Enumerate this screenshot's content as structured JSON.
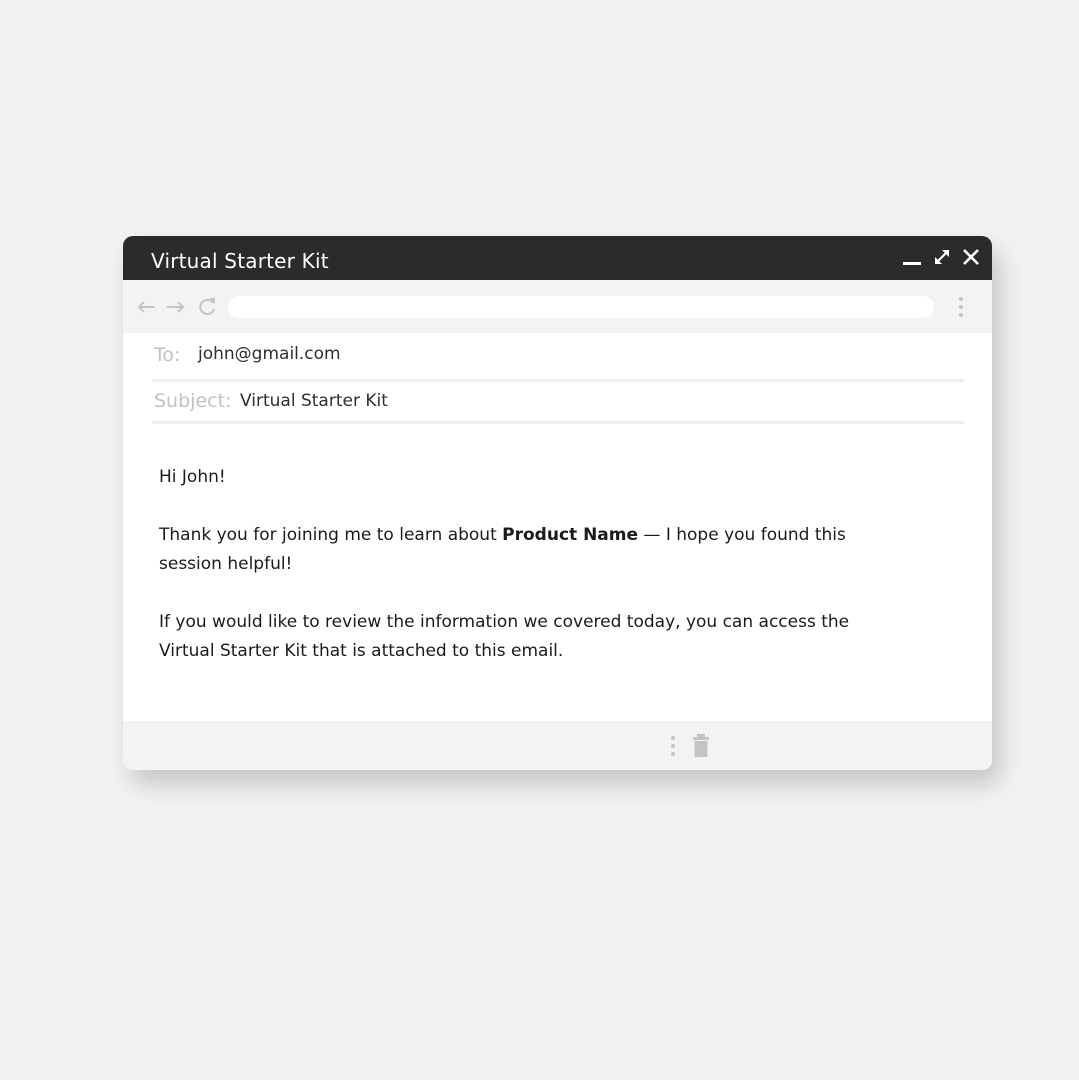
{
  "window": {
    "title": "Virtual Starter Kit",
    "controls": [
      "minimize-icon",
      "expand-icon",
      "close-icon"
    ]
  },
  "toolbar": {
    "icons": [
      "back-arrow-icon",
      "forward-arrow-icon",
      "reload-icon",
      "more-vertical-icon"
    ],
    "url": ""
  },
  "compose": {
    "to_label": "To:",
    "to_value": "john@gmail.com",
    "subject_label": "Subject:",
    "subject_value": "Virtual Starter Kit"
  },
  "message": {
    "greeting": "Hi John!",
    "p1_before": "Thank you for joining me to learn about ",
    "p1_bold": "Product Name",
    "p1_after": " — I hope you found this session helpful!",
    "p2": "If you would like to review the information we covered today, you can access the Virtual Starter Kit that is attached to this email."
  },
  "footer": {
    "icons": [
      "more-vertical-icon",
      "trash-icon"
    ]
  },
  "colors": {
    "background": "#f1f2f1",
    "titlebar": "#2b2b2b",
    "toolbar": "#f3f3f3",
    "muted_icon": "#c4c4c4"
  }
}
